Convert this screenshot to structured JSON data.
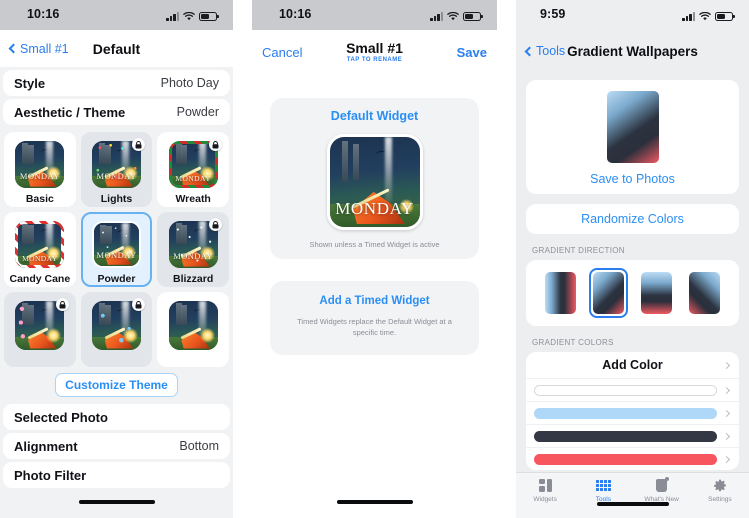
{
  "phone1": {
    "status": {
      "time": "10:16",
      "icons": [
        "cellular-icon",
        "wifi-icon",
        "battery-icon"
      ]
    },
    "nav": {
      "back_label": "Small #1",
      "title": "Default",
      "back_icon": "chevron-left-icon"
    },
    "top_rows": [
      {
        "label": "Style",
        "value": "Photo Day"
      },
      {
        "label": "Aesthetic / Theme",
        "value": "Powder"
      }
    ],
    "themes": [
      {
        "label": "Basic",
        "locked": false,
        "selected": false
      },
      {
        "label": "Lights",
        "locked": true,
        "selected": false
      },
      {
        "label": "Wreath",
        "locked": true,
        "selected": false
      },
      {
        "label": "Candy Cane",
        "locked": false,
        "selected": false
      },
      {
        "label": "Powder",
        "locked": false,
        "selected": true
      },
      {
        "label": "Blizzard",
        "locked": true,
        "selected": false
      },
      {
        "label": "",
        "locked": true,
        "selected": false
      },
      {
        "label": "",
        "locked": true,
        "selected": false
      },
      {
        "label": "",
        "locked": false,
        "selected": false
      }
    ],
    "customize_button": "Customize Theme",
    "bottom_rows": [
      {
        "label": "Selected Photo",
        "value": ""
      },
      {
        "label": "Alignment",
        "value": "Bottom"
      },
      {
        "label": "Photo Filter",
        "value": ""
      }
    ],
    "widget_word": "MONDAY"
  },
  "phone2": {
    "status": {
      "time": "10:16"
    },
    "nav": {
      "cancel": "Cancel",
      "title": "Small #1",
      "subtitle": "TAP TO RENAME",
      "save": "Save"
    },
    "default_card": {
      "title": "Default Widget",
      "widget_word": "MONDAY",
      "footnote": "Shown unless a Timed Widget is active"
    },
    "timed_card": {
      "title": "Add a Timed Widget",
      "subtitle": "Timed Widgets replace the Default Widget at a specific time."
    }
  },
  "phone3": {
    "status": {
      "time": "9:59"
    },
    "nav": {
      "back_label": "Tools",
      "title": "Gradient Wallpapers",
      "back_icon": "chevron-left-icon"
    },
    "save_to_photos": "Save to Photos",
    "randomize": "Randomize Colors",
    "direction_header": "GRADIENT DIRECTION",
    "directions": [
      {
        "name": "horizontal",
        "selected": false
      },
      {
        "name": "diagonal-down-right",
        "selected": true
      },
      {
        "name": "vertical",
        "selected": false
      },
      {
        "name": "diagonal-down-left",
        "selected": false
      }
    ],
    "colors_header": "GRADIENT COLORS",
    "add_color": "Add Color",
    "colors": [
      {
        "hex": "#FFFFFF",
        "outline": true
      },
      {
        "hex": "#AFD8F8",
        "outline": false
      },
      {
        "hex": "#343845",
        "outline": false
      },
      {
        "hex": "#F8565F",
        "outline": false
      }
    ],
    "tabs": [
      {
        "label": "Widgets",
        "icon": "widgets-icon",
        "active": false
      },
      {
        "label": "Tools",
        "icon": "grid-icon",
        "active": true
      },
      {
        "label": "What's New",
        "icon": "news-icon",
        "active": false
      },
      {
        "label": "Settings",
        "icon": "gear-icon",
        "active": false
      }
    ]
  },
  "accent": "#2A8FF5"
}
